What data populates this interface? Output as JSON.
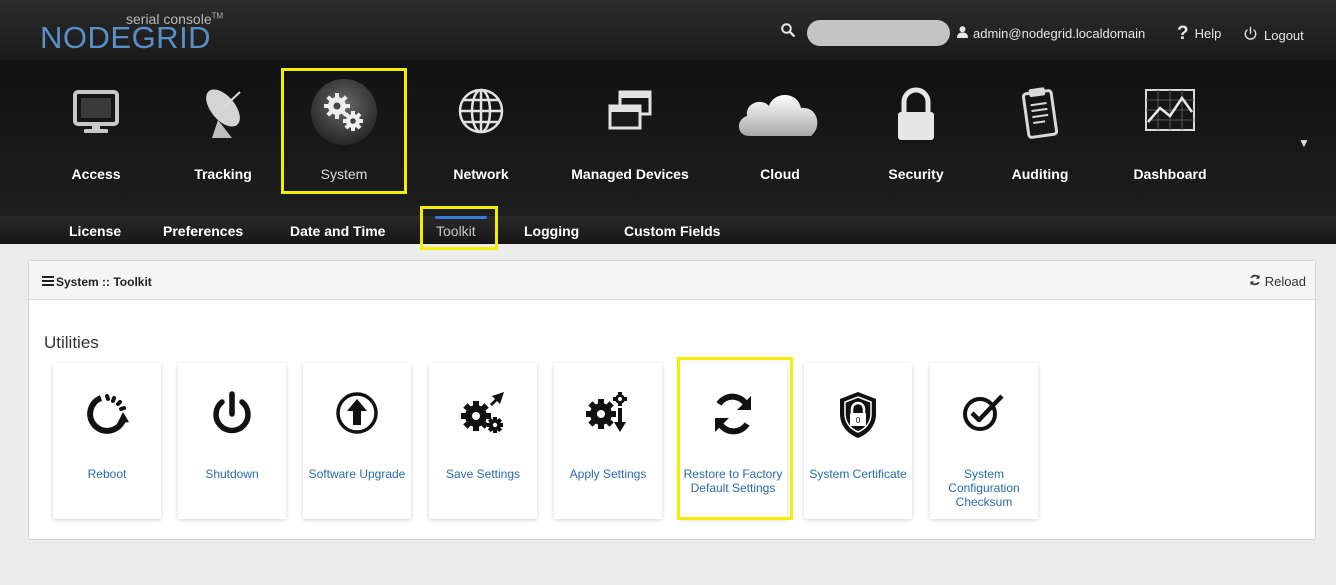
{
  "brand": {
    "small": "serial console",
    "trademark": "TM",
    "name": "NODEGRID",
    "color": "#5a8fc6"
  },
  "header": {
    "search_placeholder": "",
    "user": "admin@nodegrid.localdomain",
    "help": "Help",
    "logout": "Logout"
  },
  "nav": {
    "items": [
      {
        "label": "Access",
        "icon": "monitor-icon"
      },
      {
        "label": "Tracking",
        "icon": "satellite-dish-icon"
      },
      {
        "label": "System",
        "icon": "gears-icon",
        "active": true
      },
      {
        "label": "Network",
        "icon": "globe-icon"
      },
      {
        "label": "Managed Devices",
        "icon": "windows-icon"
      },
      {
        "label": "Cloud",
        "icon": "cloud-icon"
      },
      {
        "label": "Security",
        "icon": "padlock-icon"
      },
      {
        "label": "Auditing",
        "icon": "clipboard-icon"
      },
      {
        "label": "Dashboard",
        "icon": "line-chart-icon"
      }
    ]
  },
  "subnav": {
    "items": [
      {
        "label": "License"
      },
      {
        "label": "Preferences"
      },
      {
        "label": "Date and Time"
      },
      {
        "label": "Toolkit",
        "active": true
      },
      {
        "label": "Logging"
      },
      {
        "label": "Custom Fields"
      }
    ]
  },
  "panel": {
    "title": "System :: Toolkit",
    "reload": "Reload",
    "section": "Utilities",
    "tiles": [
      {
        "label": "Reboot",
        "icon": "reboot-icon"
      },
      {
        "label": "Shutdown",
        "icon": "power-icon"
      },
      {
        "label": "Software Upgrade",
        "icon": "upload-arrow-icon"
      },
      {
        "label": "Save Settings",
        "icon": "gears-save-icon"
      },
      {
        "label": "Apply Settings",
        "icon": "gears-apply-icon"
      },
      {
        "label": "Restore to Factory Default Settings",
        "icon": "restore-icon"
      },
      {
        "label": "System Certificate",
        "icon": "shield-lock-icon"
      },
      {
        "label": "System Configuration Checksum",
        "icon": "check-circle-icon"
      }
    ]
  },
  "colors": {
    "highlight": "#f5ee00",
    "link": "#2a6aad",
    "active_indicator": "#3a7bd5"
  }
}
